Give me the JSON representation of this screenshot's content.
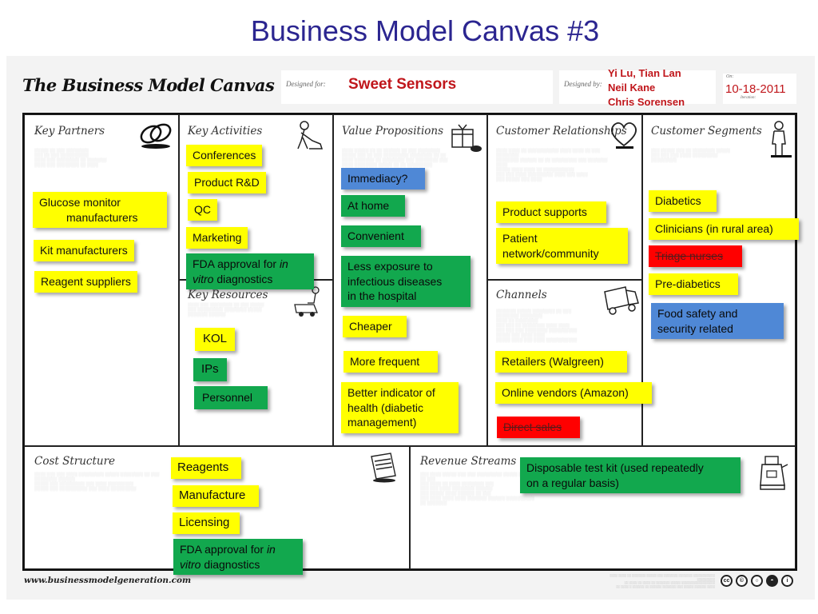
{
  "slide_title": "Business Model Canvas #3",
  "canvas_title": "The Business Model Canvas",
  "header": {
    "designed_for_label": "Designed for:",
    "designed_for_value": "Sweet Sensors",
    "designed_by_label": "Designed by:",
    "designed_by_names": [
      "Yi Lu, Tian Lan",
      "Neil Kane",
      "Chris Sorensen"
    ],
    "on_label": "On:",
    "date": "10-18-2011",
    "iteration_label": "Iteration:"
  },
  "colors": {
    "yellow_note": "#ffff00",
    "green_note": "#12a84e",
    "blue_note": "#4f88d6",
    "red_note": "#ff0000",
    "title": "#2b2590",
    "header_value": "#c0161b"
  },
  "sections": {
    "key_partners": {
      "title": "Key Partners",
      "icon": "chain-links-icon",
      "notes": [
        {
          "color": "yellow",
          "lines": [
            "Glucose monitor",
            "manufacturers"
          ]
        },
        {
          "color": "yellow",
          "lines": [
            "Kit manufacturers"
          ]
        },
        {
          "color": "yellow",
          "lines": [
            "Reagent suppliers"
          ]
        }
      ]
    },
    "key_activities": {
      "title": "Key Activities",
      "icon": "worker-icon",
      "notes": [
        {
          "color": "yellow",
          "lines": [
            "Conferences"
          ]
        },
        {
          "color": "yellow",
          "lines": [
            "Product R&D"
          ]
        },
        {
          "color": "yellow",
          "lines": [
            "QC"
          ]
        },
        {
          "color": "yellow",
          "lines": [
            "Marketing"
          ]
        },
        {
          "color": "green",
          "prefix": "FDA approval for ",
          "italic1": "in",
          "italic2": "vitro",
          "suffix": " diagnostics"
        }
      ]
    },
    "key_resources": {
      "title": "Key Resources",
      "icon": "forklift-icon",
      "notes": [
        {
          "color": "yellow",
          "lines": [
            "KOL"
          ]
        },
        {
          "color": "green",
          "lines": [
            "IPs"
          ]
        },
        {
          "color": "green",
          "lines": [
            "Personnel"
          ]
        }
      ]
    },
    "value_propositions": {
      "title": "Value Propositions",
      "icon": "gift-icon",
      "notes": [
        {
          "color": "blue",
          "lines": [
            "Immediacy?"
          ]
        },
        {
          "color": "green",
          "lines": [
            "At home"
          ]
        },
        {
          "color": "green",
          "lines": [
            "Convenient"
          ]
        },
        {
          "color": "green",
          "lines": [
            "Less exposure to",
            "infectious diseases",
            "in the hospital"
          ]
        },
        {
          "color": "yellow",
          "lines": [
            "Cheaper"
          ]
        },
        {
          "color": "yellow",
          "lines": [
            "More frequent"
          ]
        },
        {
          "color": "yellow",
          "lines": [
            "Better indicator of",
            "health (diabetic",
            "management)"
          ]
        }
      ]
    },
    "customer_relationships": {
      "title": "Customer Relationships",
      "icon": "heart-icon",
      "notes": [
        {
          "color": "yellow",
          "lines": [
            "Product supports"
          ]
        },
        {
          "color": "yellow",
          "lines": [
            "Patient",
            "network/community"
          ]
        }
      ]
    },
    "channels": {
      "title": "Channels",
      "icon": "truck-icon",
      "notes": [
        {
          "color": "yellow",
          "lines": [
            "Retailers (Walgreen)"
          ]
        },
        {
          "color": "yellow",
          "lines": [
            "Online vendors (Amazon)"
          ]
        },
        {
          "color": "red",
          "strikethrough": true,
          "lines": [
            "Direct sales"
          ]
        }
      ]
    },
    "customer_segments": {
      "title": "Customer Segments",
      "icon": "person-icon",
      "notes": [
        {
          "color": "yellow",
          "lines": [
            "Diabetics"
          ]
        },
        {
          "color": "yellow",
          "lines": [
            "Clinicians (in rural area)"
          ]
        },
        {
          "color": "red",
          "strikethrough": true,
          "lines": [
            "Triage nurses"
          ]
        },
        {
          "color": "yellow",
          "lines": [
            "Pre-diabetics"
          ]
        },
        {
          "color": "blue",
          "lines": [
            "Food safety and",
            "security related"
          ]
        }
      ]
    },
    "cost_structure": {
      "title": "Cost Structure",
      "icon": "receipt-icon",
      "notes": [
        {
          "color": "yellow",
          "lines": [
            "Reagents"
          ]
        },
        {
          "color": "yellow",
          "lines": [
            "Manufacture"
          ]
        },
        {
          "color": "yellow",
          "lines": [
            "Licensing"
          ]
        },
        {
          "color": "green",
          "prefix": "FDA approval for ",
          "italic1": "in",
          "italic2": "vitro",
          "suffix": " diagnostics"
        }
      ]
    },
    "revenue_streams": {
      "title": "Revenue Streams",
      "icon": "cash-register-icon",
      "notes": [
        {
          "color": "green",
          "lines": [
            "Disposable test kit (used repeatedly",
            "on a regular basis)"
          ]
        }
      ]
    }
  },
  "footer": {
    "url": "www.businessmodelgeneration.com",
    "license_icons": [
      "cc-icon",
      "copyright-icon",
      "share-alike-icon",
      "noncommercial-icon",
      "attribution-icon"
    ]
  }
}
